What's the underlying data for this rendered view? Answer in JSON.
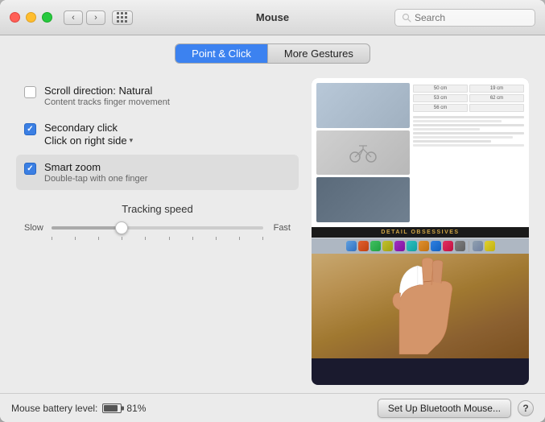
{
  "window": {
    "title": "Mouse"
  },
  "titlebar": {
    "back_label": "‹",
    "forward_label": "›",
    "search_placeholder": "Search"
  },
  "tabs": {
    "point_click": "Point & Click",
    "more_gestures": "More Gestures"
  },
  "options": [
    {
      "id": "scroll-direction",
      "checked": false,
      "title": "Scroll direction: Natural",
      "subtitle": "Content tracks finger movement"
    },
    {
      "id": "secondary-click",
      "checked": true,
      "title": "Secondary click",
      "subtitle": "Click on right side",
      "has_dropdown": true
    },
    {
      "id": "smart-zoom",
      "checked": true,
      "title": "Smart zoom",
      "subtitle": "Double-tap with one finger"
    }
  ],
  "tracking": {
    "label": "Tracking speed",
    "slow_label": "Slow",
    "fast_label": "Fast",
    "value": 35
  },
  "preview": {
    "detail_banner": "DETAIL OBSESSIVES",
    "web_numbers": [
      "50 cm",
      "19 cm",
      "53 cm",
      "62 cm",
      "56 cm",
      ""
    ]
  },
  "status": {
    "battery_label": "Mouse battery level:",
    "battery_percent": "81%",
    "bluetooth_btn": "Set Up Bluetooth Mouse...",
    "help_label": "?"
  }
}
